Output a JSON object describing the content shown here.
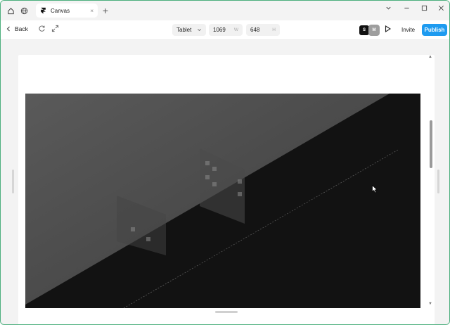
{
  "titlebar": {
    "tab_title": "Canvas",
    "tab_close": "×",
    "new_tab": "+"
  },
  "toolbar": {
    "back_label": "Back",
    "device_select": "Tablet",
    "width_value": "1069",
    "width_suffix": "W",
    "height_value": "648",
    "height_suffix": "H",
    "avatar_1": "S",
    "avatar_2": "M",
    "invite_label": "Invite",
    "publish_label": "Publish"
  },
  "colors": {
    "accent": "#1e9bf0",
    "window_border": "#4caf7d"
  },
  "icons": [
    "home-icon",
    "globe-icon",
    "framer-logo-icon",
    "refresh-icon",
    "expand-icon",
    "play-icon",
    "minimize-icon",
    "maximize-icon",
    "close-icon",
    "chevron-down-icon"
  ]
}
